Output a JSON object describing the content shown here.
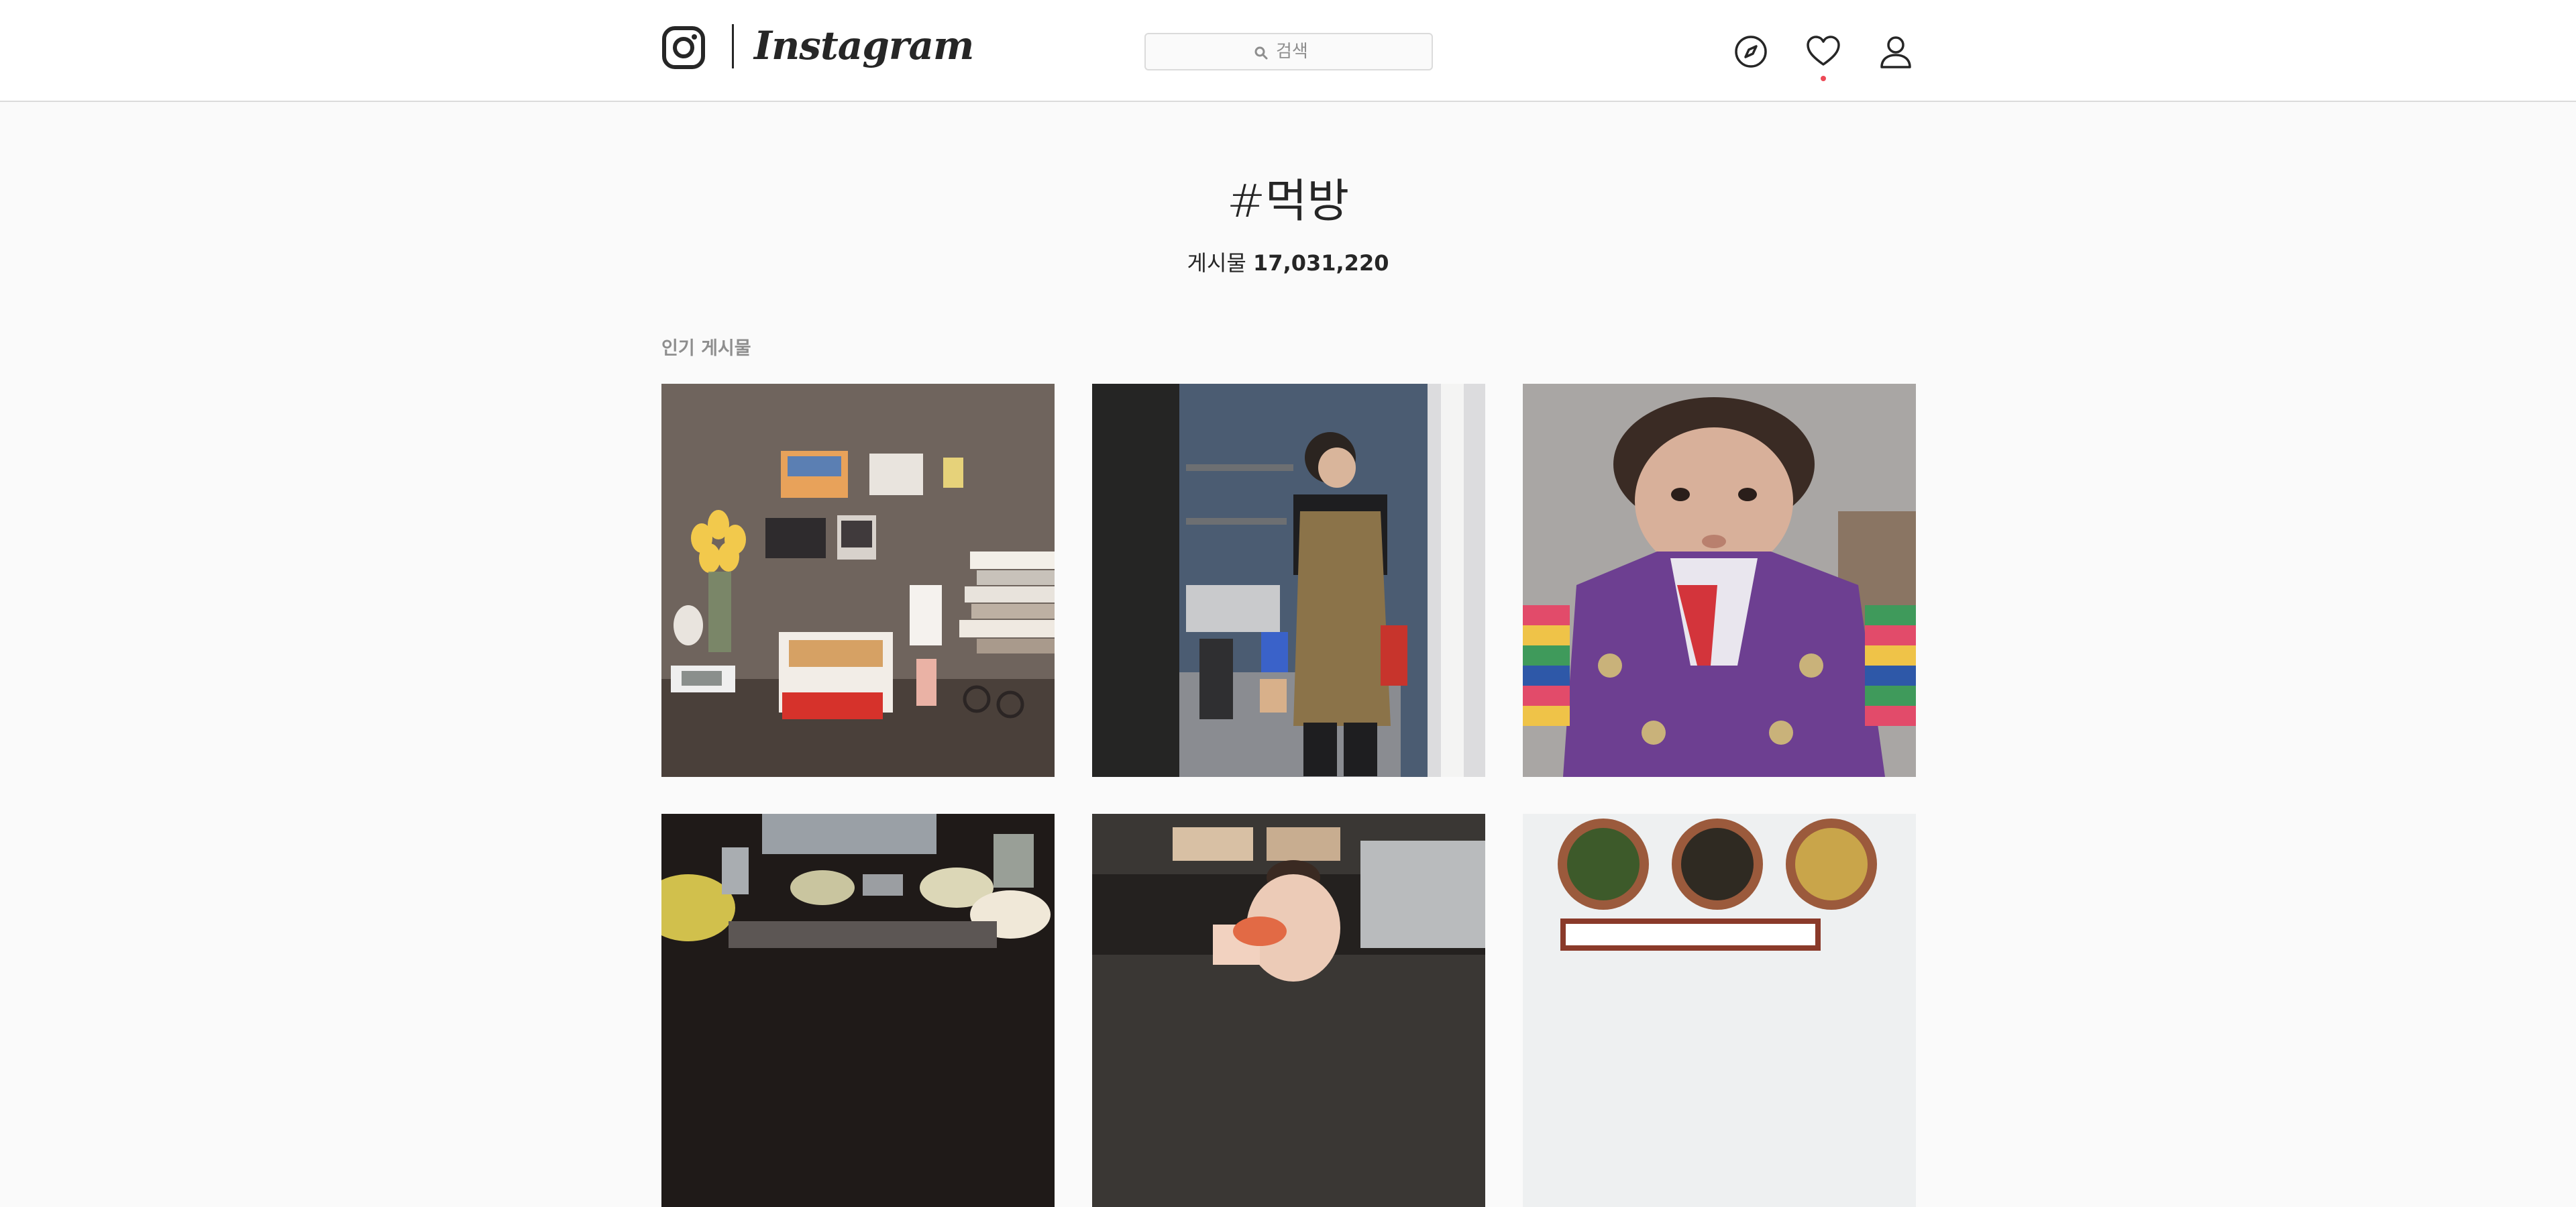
{
  "app": {
    "name": "Instagram"
  },
  "search": {
    "placeholder": "검색"
  },
  "nav": {
    "explore_icon": "compass-icon",
    "activity_icon": "heart-icon",
    "profile_icon": "user-icon",
    "notification_color": "#ed4956"
  },
  "hashtag": {
    "title": "#먹방",
    "posts_label": "게시물",
    "posts_count": "17,031,220"
  },
  "top_posts": {
    "label": "인기 게시물",
    "tiles": [
      {
        "subject": "desk with yellow tulips, pizza box and photos"
      },
      {
        "subject": "man in brown apron in kitchen doorway"
      },
      {
        "subject": "toddler in colorful hanbok"
      },
      {
        "subject": "table with side dishes and grill"
      },
      {
        "subject": "woman holding food up to face"
      },
      {
        "subject": "three plates of namul side dishes"
      }
    ]
  },
  "colors": {
    "background": "#fafafa",
    "border": "#dbdbdb",
    "text": "#262626",
    "muted": "#8e8e8e"
  }
}
